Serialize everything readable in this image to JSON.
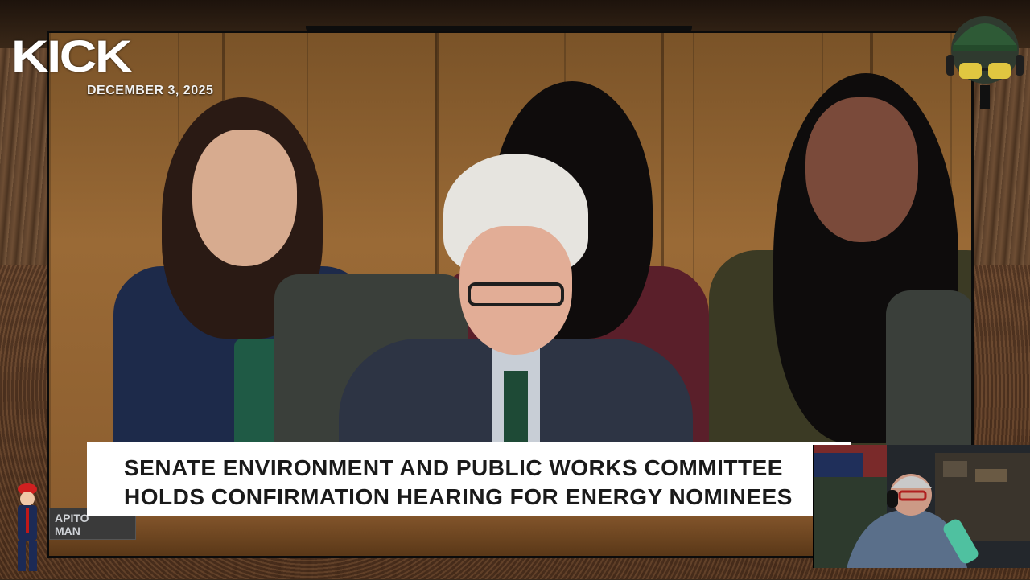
{
  "stream": {
    "logo": "KICK",
    "date": "DECEMBER 3, 2025"
  },
  "video": {
    "nameplate_lines": [
      "APITO",
      "MAN"
    ],
    "lower_third": {
      "line1": "SENATE ENVIRONMENT AND PUBLIC WORKS COMMITTEE",
      "line2": "HOLDS CONFIRMATION HEARING FOR ENERGY NOMINEES"
    }
  },
  "icons": {
    "avatar": "avatar-icon",
    "webcam": "webcam-feed",
    "mini_figure": "mascot-icon"
  },
  "colors": {
    "logo": "#ffffff",
    "lower_third_bg": "#ffffff",
    "lower_third_text": "#1a1a1a"
  }
}
